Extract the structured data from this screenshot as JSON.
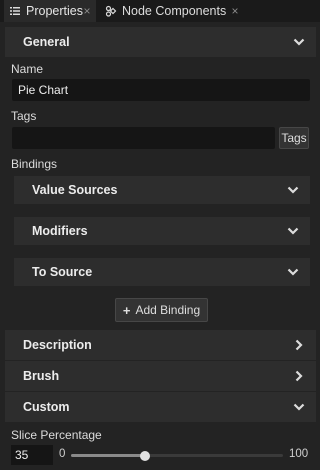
{
  "tabs": [
    {
      "label": "Properties",
      "icon": "list-icon",
      "close": "×"
    },
    {
      "label": "Node Components",
      "icon": "node-components-icon",
      "close": "×"
    }
  ],
  "sections": {
    "general": {
      "label": "General",
      "expanded": true
    },
    "description": {
      "label": "Description",
      "expanded": false
    },
    "brush": {
      "label": "Brush",
      "expanded": false
    },
    "custom": {
      "label": "Custom",
      "expanded": true
    }
  },
  "fields": {
    "name_label": "Name",
    "name_value": "Pie Chart",
    "tags_label": "Tags",
    "tags_value": "",
    "tags_button": "Tags"
  },
  "bindings": {
    "label": "Bindings",
    "rows": [
      {
        "label": "Value Sources",
        "expanded": false
      },
      {
        "label": "Modifiers",
        "expanded": false
      },
      {
        "label": "To Source",
        "expanded": false
      }
    ],
    "add_button_icon": "+",
    "add_button_label": "Add Binding"
  },
  "slice_percentage": {
    "label": "Slice Percentage",
    "value": "35",
    "min": "0",
    "max": "100",
    "fraction": 0.35
  },
  "colors": {
    "background": "#232323",
    "header": "#2d2d2d",
    "field": "#151515",
    "text": "#e6e6e6"
  }
}
